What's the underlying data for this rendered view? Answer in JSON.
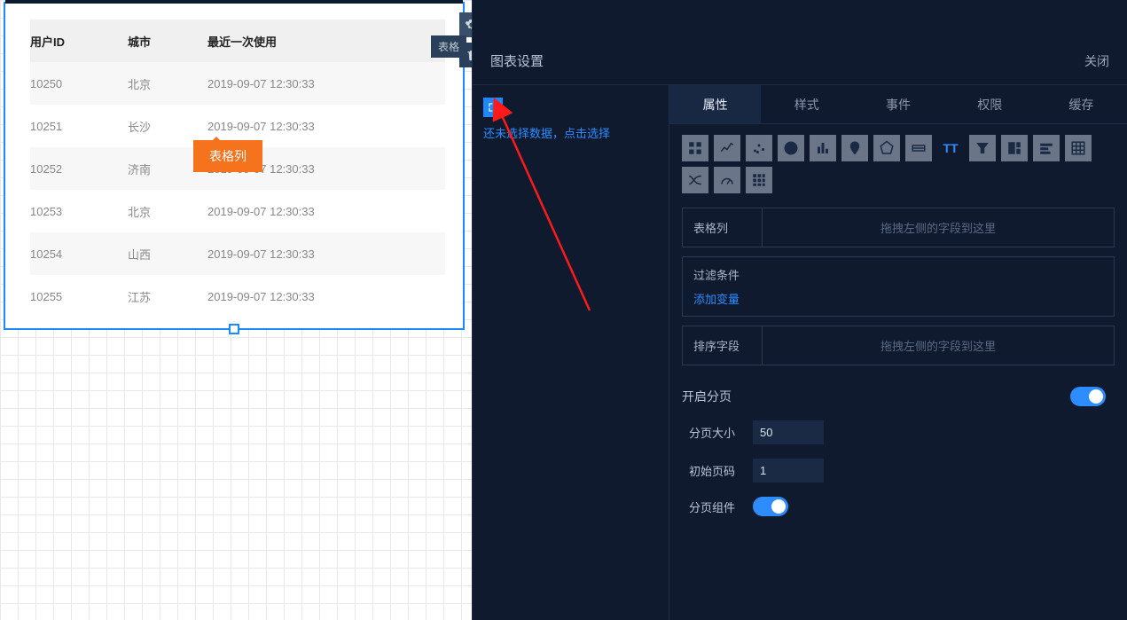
{
  "canvas": {
    "tooltip": "表格列",
    "widget_badge": "表格",
    "table": {
      "columns": [
        "用户ID",
        "城市",
        "最近一次使用"
      ],
      "rows": [
        {
          "id": "10250",
          "city": "北京",
          "date": "2019-09-07 12:30:33"
        },
        {
          "id": "10251",
          "city": "长沙",
          "date": "2019-09-07 12:30:33"
        },
        {
          "id": "10252",
          "city": "济南",
          "date": "2019-09-07 12:30:33"
        },
        {
          "id": "10253",
          "city": "北京",
          "date": "2019-09-07 12:30:33"
        },
        {
          "id": "10254",
          "city": "山西",
          "date": "2019-09-07 12:30:33"
        },
        {
          "id": "10255",
          "city": "江苏",
          "date": "2019-09-07 12:30:33"
        }
      ]
    }
  },
  "panel": {
    "title": "图表设置",
    "close": "关闭",
    "data_select_prompt": "还未选择数据，点击选择",
    "tabs": [
      "属性",
      "样式",
      "事件",
      "权限",
      "缓存"
    ],
    "active_tab": "属性",
    "chart_type_icons": [
      "heatmap",
      "line",
      "scatter",
      "pie",
      "bar",
      "map",
      "radar",
      "boxplot",
      "text",
      "funnel",
      "treemap",
      "gauge-strip",
      "table",
      "sankey",
      "gauge",
      "grid"
    ],
    "fields": {
      "table_col_label": "表格列",
      "drop_placeholder": "拖拽左侧的字段到这里",
      "filter_label": "过滤条件",
      "add_var": "添加变量",
      "sort_label": "排序字段"
    },
    "paging": {
      "enable_label": "开启分页",
      "size_label": "分页大小",
      "size_value": "50",
      "initial_label": "初始页码",
      "initial_value": "1",
      "widget_label": "分页组件"
    }
  }
}
